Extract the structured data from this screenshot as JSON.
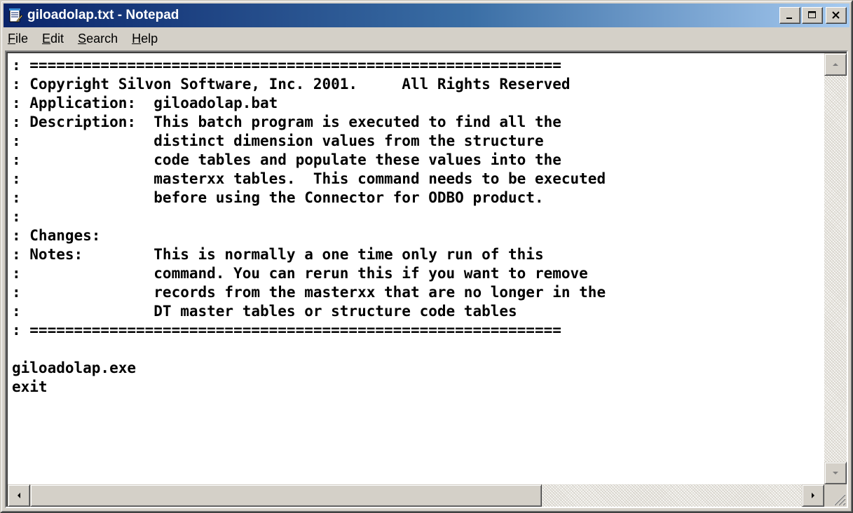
{
  "window": {
    "title": "giloadolap.txt - Notepad",
    "icon": "notepad-icon"
  },
  "menu": {
    "items": [
      {
        "label": "File",
        "accel": "F",
        "rest": "ile"
      },
      {
        "label": "Edit",
        "accel": "E",
        "rest": "dit"
      },
      {
        "label": "Search",
        "accel": "S",
        "rest": "earch"
      },
      {
        "label": "Help",
        "accel": "H",
        "rest": "elp"
      }
    ]
  },
  "editor": {
    "lines": [
      ": ============================================================",
      ": Copyright Silvon Software, Inc. 2001.     All Rights Reserved",
      ": Application:  giloadolap.bat",
      ": Description:  This batch program is executed to find all the",
      ":               distinct dimension values from the structure",
      ":               code tables and populate these values into the",
      ":               masterxx tables.  This command needs to be executed",
      ":               before using the Connector for ODBO product.",
      ":",
      ": Changes:",
      ": Notes:        This is normally a one time only run of this",
      ":               command. You can rerun this if you want to remove",
      ":               records from the masterxx that are no longer in the",
      ":               DT master tables or structure code tables",
      ": ============================================================",
      "",
      "giloadolap.exe",
      "exit"
    ]
  },
  "colors": {
    "title_active": "#0a246a",
    "title_gradient_end": "#a6caf0",
    "face": "#d4d0c8"
  }
}
